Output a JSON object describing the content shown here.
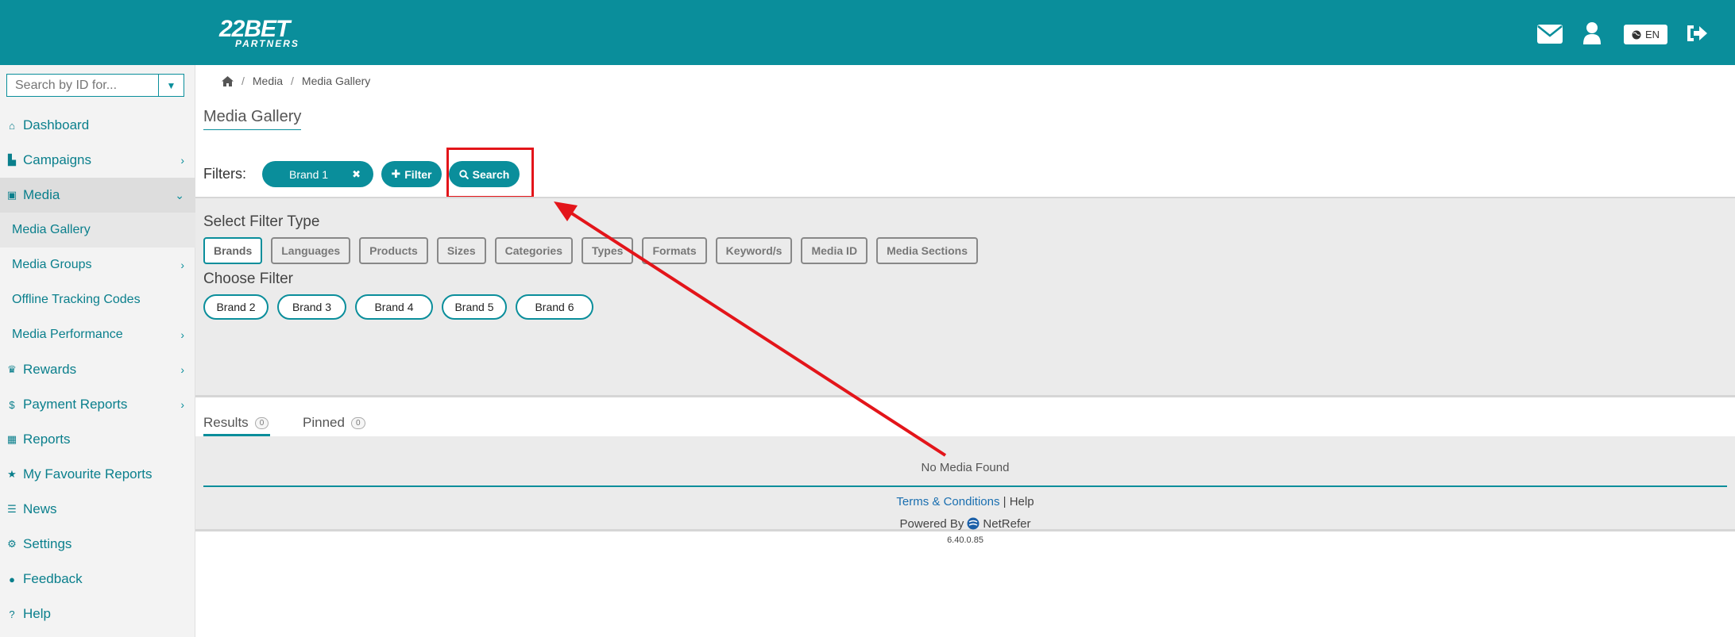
{
  "header": {
    "logo_main": "22BET",
    "logo_sub": "PARTNERS",
    "language": "EN",
    "icons": [
      "envelope-icon",
      "user-icon",
      "globe-icon",
      "logout-icon"
    ],
    "bg_color": "#0a8e9b"
  },
  "sidebar": {
    "search_placeholder": "Search by ID for...",
    "items": [
      {
        "label": "Dashboard",
        "icon": "home-icon"
      },
      {
        "label": "Campaigns",
        "icon": "bar-chart-icon",
        "chevron": "›"
      },
      {
        "label": "Media",
        "icon": "image-icon",
        "chevron": "⌄"
      },
      {
        "label": "Media Gallery"
      },
      {
        "label": "Media Groups",
        "chevron": "›"
      },
      {
        "label": "Offline Tracking Codes"
      },
      {
        "label": "Media Performance",
        "chevron": "›"
      },
      {
        "label": "Rewards",
        "icon": "trophy-icon",
        "chevron": "›"
      },
      {
        "label": "Payment Reports",
        "icon": "dollar-icon",
        "chevron": "›"
      },
      {
        "label": "Reports",
        "icon": "table-icon"
      },
      {
        "label": "My Favourite Reports",
        "icon": "star-icon"
      },
      {
        "label": "News",
        "icon": "list-icon"
      },
      {
        "label": "Settings",
        "icon": "gear-icon"
      },
      {
        "label": "Feedback",
        "icon": "comment-icon"
      },
      {
        "label": "Help",
        "icon": "question-icon"
      }
    ]
  },
  "breadcrumb": {
    "home_icon": "home-icon",
    "sep": "/",
    "items": [
      "Media",
      "Media Gallery"
    ]
  },
  "page": {
    "title": "Media Gallery",
    "filters_label": "Filters:",
    "active_filter": "Brand 1",
    "remove_glyph": "✖",
    "add_filter_label": "Filter",
    "search_label": "Search"
  },
  "filter_panel": {
    "select_type_heading": "Select Filter Type",
    "types": [
      "Brands",
      "Languages",
      "Products",
      "Sizes",
      "Categories",
      "Types",
      "Formats",
      "Keyword/s",
      "Media ID",
      "Media Sections"
    ],
    "selected_type": "Brands",
    "choose_heading": "Choose Filter",
    "brands": [
      "Brand 2",
      "Brand 3",
      "Brand 4",
      "Brand 5",
      "Brand 6"
    ]
  },
  "tabs": [
    {
      "label": "Results",
      "count": "0"
    },
    {
      "label": "Pinned",
      "count": "0"
    }
  ],
  "results": {
    "empty_text": "No Media Found"
  },
  "footer": {
    "terms": "Terms & Conditions",
    "divider": "|",
    "help": "Help",
    "powered_by": "Powered By",
    "vendor": "NetRefer",
    "version": "6.40.0.85"
  },
  "annotation": {
    "color": "#e3151a"
  }
}
